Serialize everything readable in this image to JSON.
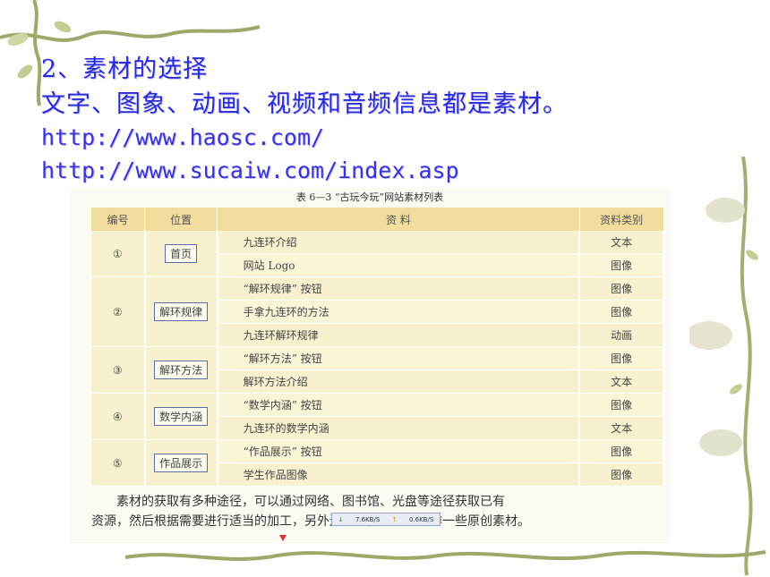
{
  "slide": {
    "heading": "2、素材的选择",
    "subtitle": "文字、图象、动画、视频和音频信息都是素材。",
    "url1": "http://www.haosc.com/",
    "url2": "http://www.sucaiw.com/index.asp"
  },
  "table": {
    "caption": "表 6—3 “古玩今玩”网站素材列表",
    "headers": [
      "编号",
      "位置",
      "资  料",
      "资料类别"
    ],
    "groups": [
      {
        "num": "①",
        "pos": "首页",
        "rows": [
          {
            "res": "九连环介绍",
            "cat": "文本"
          },
          {
            "res": "网站 Logo",
            "cat": "图像"
          }
        ]
      },
      {
        "num": "②",
        "pos": "解环规律",
        "rows": [
          {
            "res": "“解环规律” 按钮",
            "cat": "图像"
          },
          {
            "res": "手拿九连环的方法",
            "cat": "图像"
          },
          {
            "res": "九连环解环规律",
            "cat": "动画"
          }
        ]
      },
      {
        "num": "③",
        "pos": "解环方法",
        "rows": [
          {
            "res": "“解环方法” 按钮",
            "cat": "图像"
          },
          {
            "res": "解环方法介绍",
            "cat": "文本"
          }
        ]
      },
      {
        "num": "④",
        "pos": "数学内涵",
        "rows": [
          {
            "res": "“数学内涵” 按钮",
            "cat": "图像"
          },
          {
            "res": "九连环的数学内涵",
            "cat": "文本"
          }
        ]
      },
      {
        "num": "⑤",
        "pos": "作品展示",
        "rows": [
          {
            "res": "“作品展示” 按钮",
            "cat": "图像"
          },
          {
            "res": "学生作品图像",
            "cat": "图像"
          }
        ]
      }
    ]
  },
  "paragraph": {
    "line1": "素材的获取有多种途径，可以通过网络、图书馆、光盘等途径获取已有",
    "line2": "资源，然后根据需要进行适当的加工，另外还可以自己动手制作一些原创素材。"
  },
  "speed_widget": {
    "down": "7.6KB/S",
    "up": "0.6KB/S",
    "down_icon": "arrow-down-icon",
    "up_icon": "arrow-up-icon"
  },
  "colors": {
    "title_blue": "#2a2ad8",
    "table_header": "#f2dd9f",
    "table_row": "#f8f1cf",
    "vine_green": "#9fa86a"
  }
}
